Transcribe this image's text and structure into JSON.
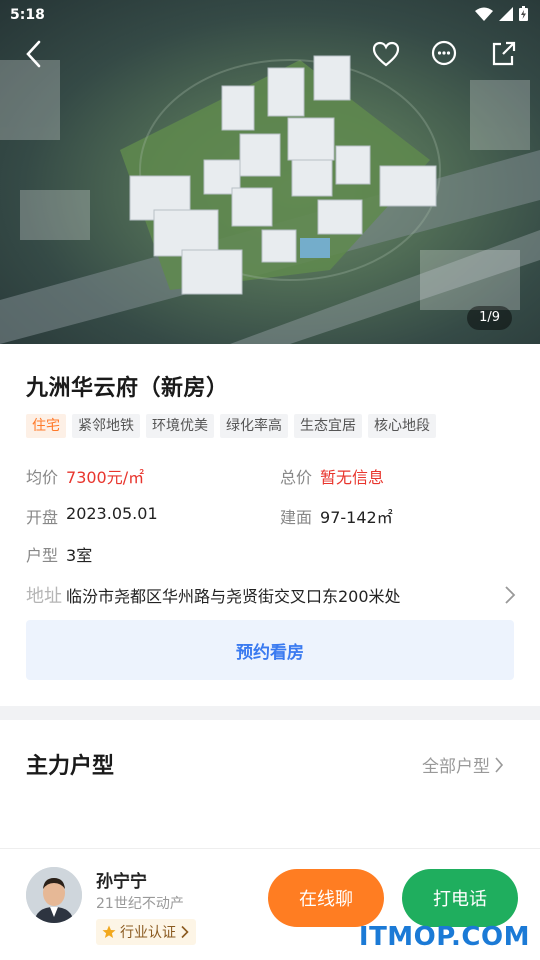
{
  "status_bar": {
    "time": "5:18"
  },
  "gallery": {
    "counter": "1/9"
  },
  "property": {
    "title": "九洲华云府（新房）",
    "tags": [
      "住宅",
      "紧邻地铁",
      "环境优美",
      "绿化率高",
      "生态宜居",
      "核心地段"
    ],
    "avg_price_label": "均价",
    "avg_price_value": "7300元/㎡",
    "total_price_label": "总价",
    "total_price_value": "暂无信息",
    "opening_label": "开盘",
    "opening_value": "2023.05.01",
    "area_label": "建面",
    "area_value": "97-142㎡",
    "layout_label": "户型",
    "layout_value": "3室",
    "address_label": "地址",
    "address_value": "临汾市尧都区华州路与尧贤街交叉口东200米处",
    "book_button": "预约看房"
  },
  "floorplans": {
    "title": "主力户型",
    "more": "全部户型"
  },
  "agent": {
    "name": "孙宁宁",
    "company": "21世纪不动产",
    "cert": "行业认证",
    "chat_button": "在线聊",
    "call_button": "打电话"
  },
  "watermark": "ITMOP.COM",
  "colors": {
    "accent_orange": "#ff7d22",
    "accent_green": "#1fae5e",
    "price_red": "#e8352d",
    "link_blue": "#3a7af0"
  }
}
